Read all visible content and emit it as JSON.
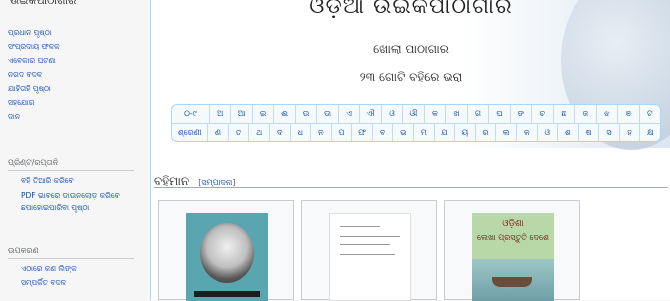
{
  "sidebar": {
    "top_cut": "ଉଇକିପାଠାଗାର",
    "nav": [
      "ପ୍ରଧାନ ପୃଷ୍ଠା",
      "ସଂପ୍ରଦାୟ ଫଳକ",
      "ଏବେକାର ଘଟଣା",
      "ନଗଦ ବଦଳ",
      "ଯାହିତାହି ପୃଷ୍ଠା",
      "ସହଯୋଗ",
      "ଦାନ"
    ],
    "print_head": "ପ୍ରିଣ୍ଟ/ରପ୍ତାନି",
    "print_items": [
      "ବହି ତିଆରି କରିବେ",
      "PDF ଭାବରେ ଡାଉନଲୋଡ଼ କରିବେ",
      "ଛପାହୋଇପାରିବା ପୃଷ୍ଠା"
    ],
    "tools_head": "ଉପକରଣ",
    "tools_items": [
      "ଏଠାରେ କଣ ଲିଙ୍କ",
      "ସମ୍ପର୍କିତ ବଦଳ"
    ]
  },
  "banner": {
    "title": "ଓଡ଼ିଆ ଉଇକିପାଠାଗାର",
    "subtitle": "ଖୋଲା ପାଠାଗାର",
    "count": "୨୩ ଗୋଟି ବହିରେ ଭରା"
  },
  "alphabet": {
    "row1": [
      "୦-୯",
      "ଅ",
      "ଆ",
      "ଇ",
      "ଈ",
      "ଉ",
      "ଊ",
      "ଏ",
      "ଐ",
      "ଓ",
      "ଔ",
      "କ",
      "ଖ",
      "ଗ",
      "ଘ",
      "ଙ",
      "ଚ",
      "ଛ",
      "ଜ",
      "ଝ",
      "ଞ",
      "ଟ"
    ],
    "row2": [
      "ଶ୍ରେଣୀ",
      "ଣ",
      "ତ",
      "ଥ",
      "ଦ",
      "ଧ",
      "ନ",
      "ପ",
      "ଫ",
      "ବ",
      "ଭ",
      "ମ",
      "ଯ",
      "ୟ",
      "ର",
      "ଲ",
      "ଳ",
      "ଓ",
      "ଶ",
      "ଷ",
      "ସ",
      "ହ",
      "କ୍ଷ"
    ]
  },
  "section": {
    "title": "ବହିମାନ",
    "edit": "ସମ୍ପାଦନା"
  },
  "books": {
    "cover3_title": "ଓଡ଼ିଶା",
    "cover3_sub": "ଲେଖା ପ୍ରସ୍ତୁତି ଦେଶେ"
  },
  "colors": {
    "link": "#0645ad",
    "border": "#a7d7f9"
  }
}
